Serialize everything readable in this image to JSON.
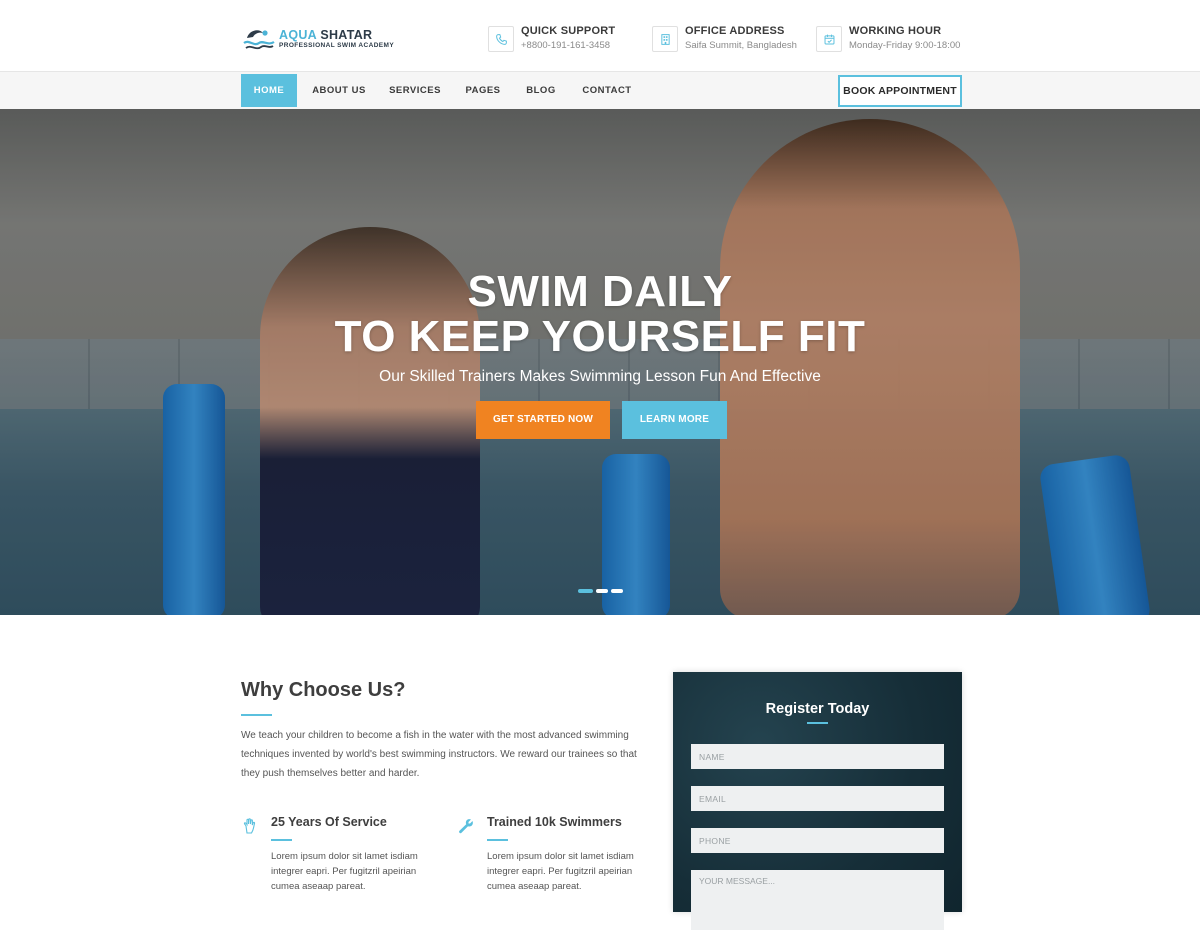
{
  "brand": {
    "name_part1": "AQUA",
    "name_part2": "SHATAR",
    "tagline": "PROFESSIONAL SWIM ACADEMY"
  },
  "contact_info": [
    {
      "title": "QUICK SUPPORT",
      "value": "+8800-191-161-3458",
      "icon": "phone-icon"
    },
    {
      "title": "OFFICE ADDRESS",
      "value": "Saifa Summit, Bangladesh",
      "icon": "building-icon"
    },
    {
      "title": "WORKING HOUR",
      "value": "Monday-Friday 9:00-18:00",
      "icon": "calendar-icon"
    }
  ],
  "nav": {
    "items": [
      "HOME",
      "ABOUT US",
      "SERVICES",
      "PAGES",
      "BLOG",
      "CONTACT"
    ],
    "active_index": 0,
    "cta": "BOOK APPOINTMENT"
  },
  "hero": {
    "title_line1": "SWIM DAILY",
    "title_line2": "TO KEEP YOURSELF FIT",
    "subtitle": "Our Skilled Trainers Makes Swimming Lesson Fun And Effective",
    "primary_button": "GET STARTED NOW",
    "secondary_button": "LEARN MORE",
    "slide_count": 3,
    "active_slide": 0
  },
  "why": {
    "title": "Why Choose Us?",
    "text": "We teach your children to become a fish in the water with the most advanced swimming techniques invented by world's best swimming instructors. We reward our trainees so that they push themselves better and harder.",
    "features": [
      {
        "title": "25 Years Of Service",
        "text": "Lorem ipsum dolor sit lamet isdiam integrer eapri. Per fugitzril apeirian cumea aseaap pareat.",
        "icon": "hand-icon"
      },
      {
        "title": "Trained 10k Swimmers",
        "text": "Lorem ipsum dolor sit lamet isdiam integrer eapri. Per fugitzril apeirian cumea aseaap pareat.",
        "icon": "wrench-icon"
      }
    ]
  },
  "register": {
    "title": "Register Today",
    "name_placeholder": "NAME",
    "email_placeholder": "EMAIL",
    "phone_placeholder": "PHONE",
    "message_placeholder": "YOUR MESSAGE..."
  },
  "colors": {
    "accent": "#5bc0de",
    "orange": "#f08321",
    "dark": "#3e3e3e",
    "register_bg": "#162e38"
  }
}
